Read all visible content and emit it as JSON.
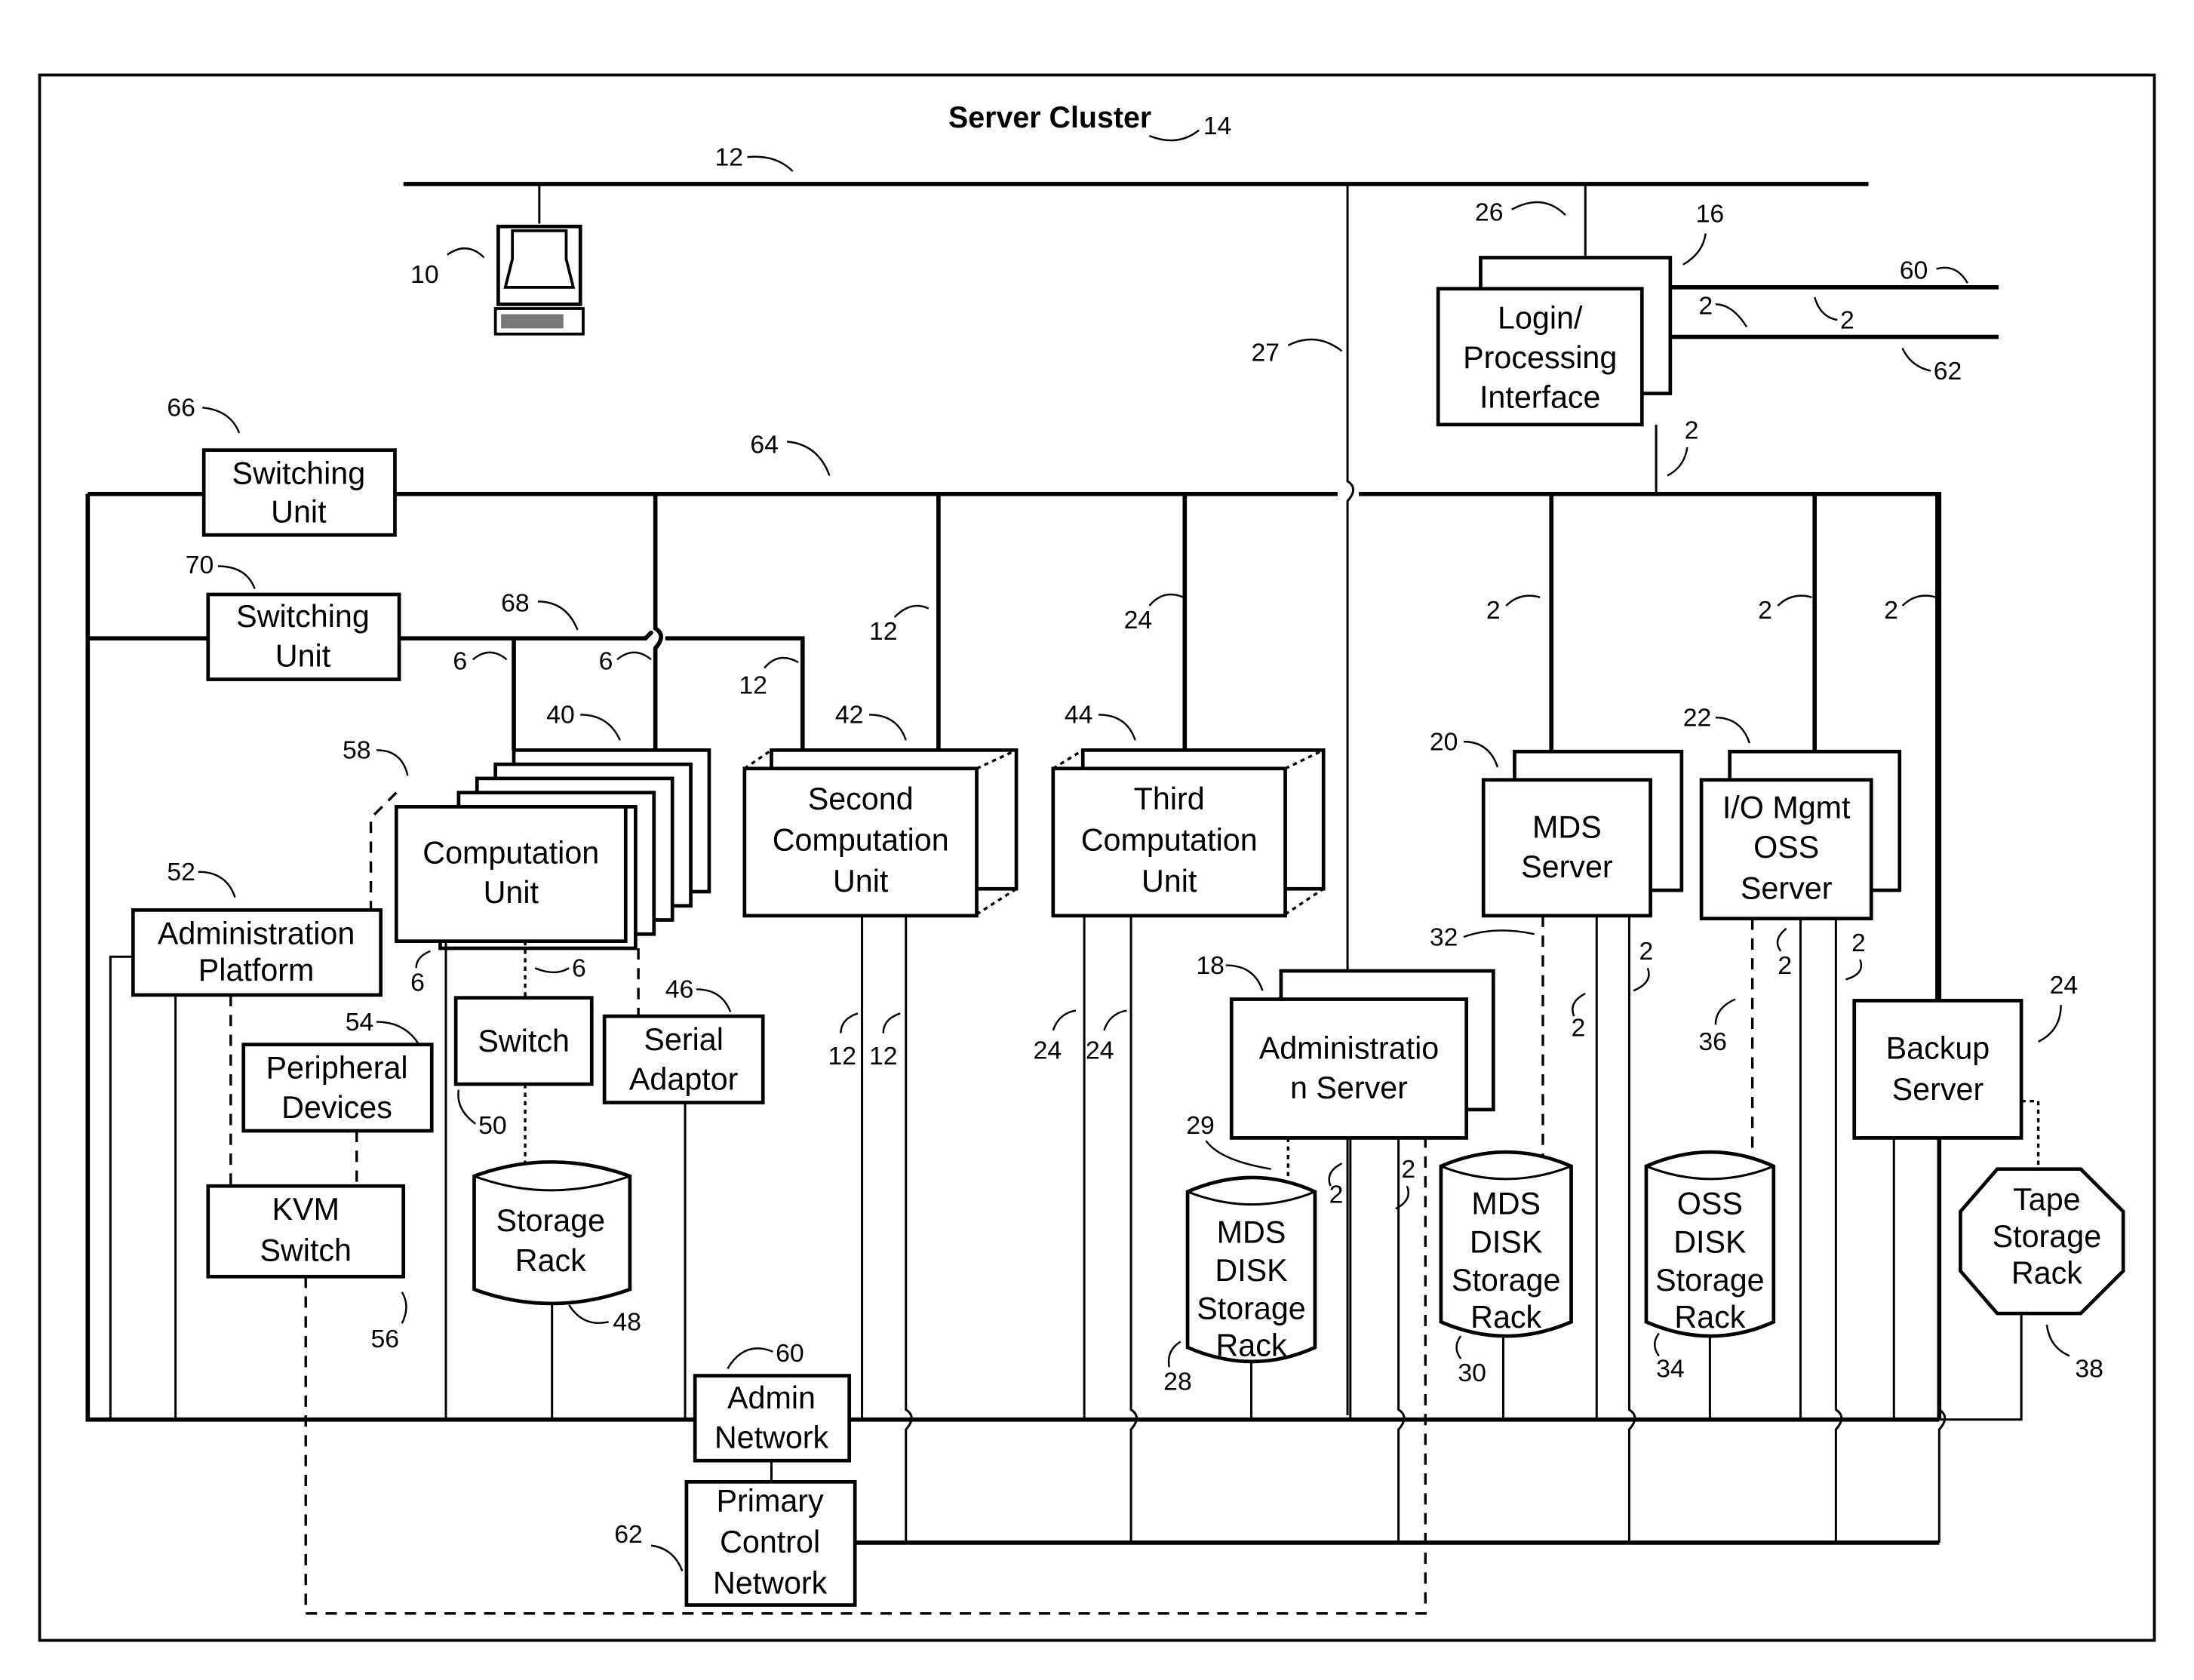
{
  "figure": {
    "title": "Server Cluster",
    "title_ref": "14"
  },
  "nodes": {
    "workstation": {
      "ref": "10"
    },
    "login": {
      "lines": [
        "Login/",
        "Processing",
        "Interface"
      ],
      "ref": "16"
    },
    "switch66": {
      "lines": [
        "Switching",
        "Unit"
      ],
      "ref": "66"
    },
    "switch70": {
      "lines": [
        "Switching",
        "Unit"
      ],
      "ref": "70"
    },
    "comp1": {
      "lines": [
        "Computation",
        "Unit"
      ],
      "ref": "40",
      "stack_ref": "58"
    },
    "comp2": {
      "lines": [
        "Second",
        "Computation",
        "Unit"
      ],
      "ref": "42"
    },
    "comp3": {
      "lines": [
        "Third",
        "Computation",
        "Unit"
      ],
      "ref": "44"
    },
    "mds_server": {
      "lines": [
        "MDS",
        "Server"
      ],
      "ref": "20"
    },
    "oss_server": {
      "lines": [
        "I/O Mgmt",
        "OSS",
        "Server"
      ],
      "ref": "22"
    },
    "admin_platform": {
      "lines": [
        "Administration",
        "Platform"
      ],
      "ref": "52"
    },
    "peripheral": {
      "lines": [
        "Peripheral",
        "Devices"
      ],
      "ref": "54"
    },
    "kvm": {
      "lines": [
        "KVM",
        "Switch"
      ],
      "ref": "56"
    },
    "switch50": {
      "lines": [
        "Switch"
      ],
      "ref": "50"
    },
    "serial": {
      "lines": [
        "Serial",
        "Adaptor"
      ],
      "ref": "46"
    },
    "storage48": {
      "lines": [
        "Storage",
        "Rack"
      ],
      "ref": "48"
    },
    "admin_server": {
      "lines": [
        "Administratio",
        "n Server"
      ],
      "ref": "18"
    },
    "mds_disk28": {
      "lines": [
        "MDS",
        "DISK",
        "Storage",
        "Rack"
      ],
      "ref": "28"
    },
    "mds_disk30": {
      "lines": [
        "MDS",
        "DISK",
        "Storage",
        "Rack"
      ],
      "ref": "30"
    },
    "oss_disk34": {
      "lines": [
        "OSS",
        "DISK",
        "Storage",
        "Rack"
      ],
      "ref": "34"
    },
    "backup": {
      "lines": [
        "Backup",
        "Server"
      ],
      "ref": "24"
    },
    "tape": {
      "lines": [
        "Tape",
        "Storage",
        "Rack"
      ],
      "ref": "38"
    },
    "admin_network": {
      "lines": [
        "Admin",
        "Network"
      ],
      "ref": "60"
    },
    "primary_network": {
      "lines": [
        "Primary",
        "Control",
        "Network"
      ],
      "ref": "62"
    }
  },
  "refs": {
    "r12_top": "12",
    "r26": "26",
    "r27": "27",
    "r60_ext": "60",
    "r62_ext": "62",
    "r2_a": "2",
    "r2_b": "2",
    "r2_login": "2",
    "r64": "64",
    "r68": "68",
    "r6_a": "6",
    "r6_b": "6",
    "r12_c": "12",
    "r12_d": "12",
    "r24_e": "24",
    "r2_f": "2",
    "r2_g": "2",
    "r2_h": "2",
    "r6_i": "6",
    "r6_j": "6",
    "r12_k": "12",
    "r12_l": "12",
    "r24_m": "24",
    "r24_n": "24",
    "r32": "32",
    "r2_o": "2",
    "r2_p": "2",
    "r36": "36",
    "r2_q": "2",
    "r2_r": "2",
    "r29": "29",
    "r2_s": "2",
    "r2_t": "2"
  }
}
